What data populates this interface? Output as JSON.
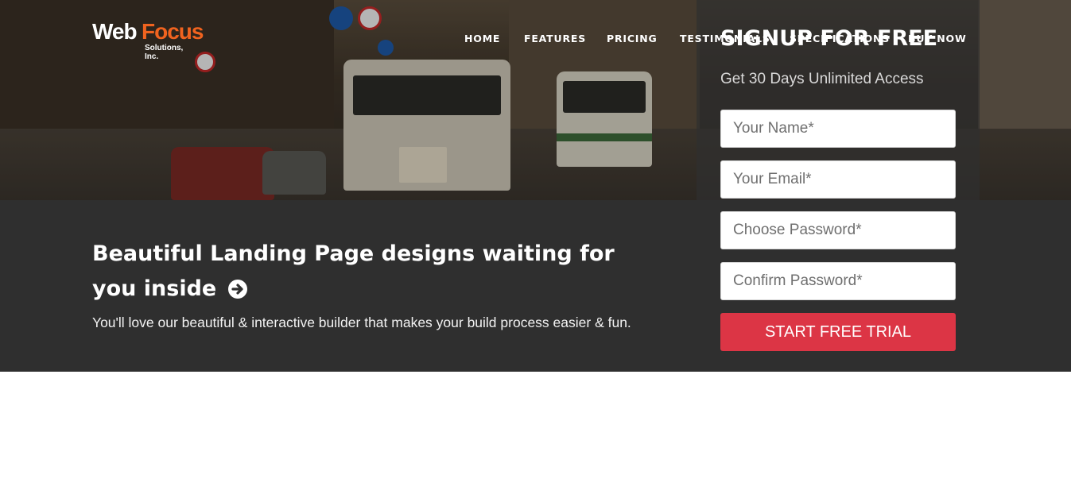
{
  "header": {
    "logo_primary": "Web",
    "logo_accent": "Focus",
    "logo_sub": "Solutions, Inc.",
    "nav": [
      "HOME",
      "FEATURES",
      "PRICING",
      "TESTIMONIALS",
      "SPECIFICATIONS",
      "BUY NOW"
    ]
  },
  "signup": {
    "title": "SIGNUP FOR FREE",
    "subtitle": "Get 30 Days Unlimited Access",
    "name_placeholder": "Your Name*",
    "email_placeholder": "Your Email*",
    "password_placeholder": "Choose Password*",
    "confirm_placeholder": "Confirm Password*",
    "cta_label": "START FREE TRIAL"
  },
  "hero": {
    "headline": "Beautiful Landing Page designs waiting for you inside",
    "headline_icon": "arrow-right-circle-icon",
    "tagline": "You'll love our beautiful & interactive builder that makes your build process easier & fun."
  },
  "colors": {
    "cta": "#dc3545",
    "band": "#2f2f2f",
    "logo_accent": "#f0631f"
  }
}
